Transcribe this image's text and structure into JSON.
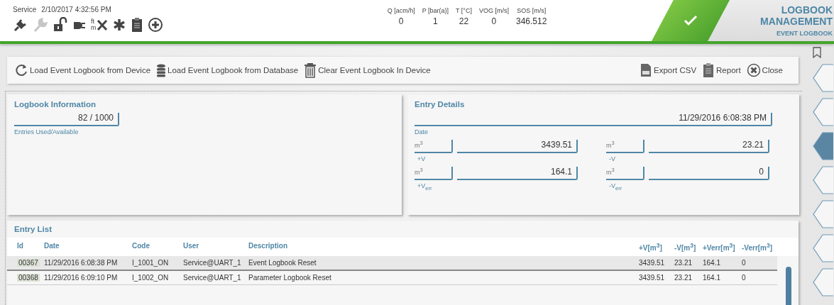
{
  "header": {
    "mode": "Service",
    "datetime": "2/10/2017 4:32:56 PM",
    "icons": [
      {
        "kind": "plug",
        "disabled": false
      },
      {
        "kind": "wrench",
        "disabled": true
      },
      {
        "kind": "lock",
        "disabled": false
      },
      {
        "kind": "plug2",
        "disabled": false
      },
      {
        "kind": "units",
        "upper": "ft",
        "lower": "m",
        "disabled": false
      },
      {
        "kind": "asterisk",
        "disabled": false
      },
      {
        "kind": "clipboard",
        "disabled": false
      },
      {
        "kind": "plus",
        "disabled": false
      }
    ],
    "measurements": [
      {
        "label": "Q [acm/h]",
        "value": "0"
      },
      {
        "label": "P [bar(a)]",
        "value": "1"
      },
      {
        "label": "T [°C]",
        "value": "22"
      },
      {
        "label": "VOG [m/s]",
        "value": "0"
      },
      {
        "label": "SOS [m/s]",
        "value": "346.512"
      }
    ],
    "title": "LOGBOOK MANAGEMENT",
    "subtitle": "EVENT LOGBOOK"
  },
  "toolbar": {
    "left": [
      {
        "kind": "refresh",
        "label": "Load Event Logbook from Device"
      },
      {
        "kind": "database",
        "label": "Load Event Logbook from Database"
      },
      {
        "kind": "trash",
        "label": "Clear Event Logbook In Device"
      }
    ],
    "right": [
      {
        "kind": "csv",
        "label": "Export CSV"
      },
      {
        "kind": "report",
        "label": "Report"
      },
      {
        "kind": "close",
        "label": "Close"
      }
    ]
  },
  "logbook_information": {
    "title": "Logbook Information",
    "value": "82 / 1000",
    "caption": "Entries Used/Available"
  },
  "entry_details": {
    "title": "Entry Details",
    "date": "11/29/2016 6:08:38 PM",
    "date_caption": "Date",
    "fields": [
      {
        "unit": "m$^{3}$",
        "value": "3439.51",
        "caption": "+V"
      },
      {
        "unit": "m$^{3}$",
        "value": "23.21",
        "caption": "-V"
      },
      {
        "unit": "m$^{3}$",
        "value": "164.1",
        "caption": "+V$_{err}$"
      },
      {
        "unit": "m$^{3}$",
        "value": "0",
        "caption": "-V$_{err}$"
      }
    ]
  },
  "entry_list": {
    "title": "Entry List",
    "columns": [
      "Id",
      "Date",
      "Code",
      "User",
      "Description",
      "+V[m$^{3}$]",
      "-V[m$^{3}$]",
      "+Verr[m$^{3}$]",
      "-Verr[m$^{3}$]"
    ],
    "rows": [
      {
        "selected": true,
        "cells": [
          "00367",
          "11/29/2016 6:08:38 PM",
          "I_1001_ON",
          "Service@UART_1",
          "Event Logbook Reset",
          "3439.51",
          "23.21",
          "164.1",
          "0"
        ]
      },
      {
        "selected": false,
        "cells": [
          "00368",
          "11/29/2016 6:09:10 PM",
          "I_1002_ON",
          "Service@UART_1",
          "Parameter Logbook Reset",
          "3439.51",
          "23.21",
          "164.1",
          "0"
        ]
      }
    ]
  },
  "side_tabs": [
    {
      "selected": false
    },
    {
      "selected": false
    },
    {
      "selected": true
    },
    {
      "selected": false
    },
    {
      "selected": false
    },
    {
      "selected": false
    },
    {
      "selected": false
    }
  ]
}
